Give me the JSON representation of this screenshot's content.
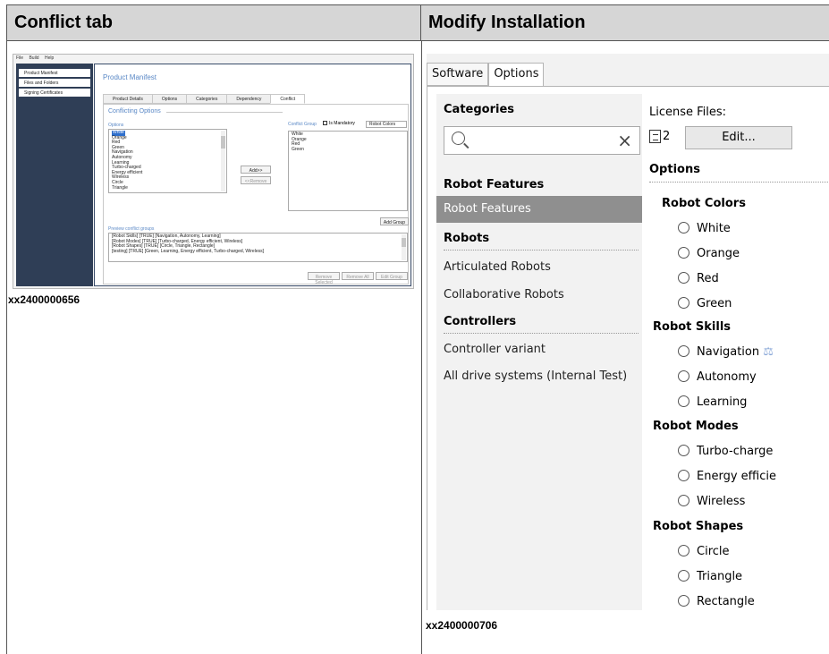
{
  "headers": {
    "left": "Conflict tab",
    "right": "Modify Installation"
  },
  "captions": {
    "left": "xx2400000656",
    "right": "xx2400000706"
  },
  "shot1": {
    "menu": [
      "File",
      "Build",
      "Help"
    ],
    "sidebar": [
      "Product Manifest",
      "Files and Folders",
      "Signing Certificates"
    ],
    "page_title": "Product Manifest",
    "tabs": [
      "Product Details",
      "Options",
      "Categories",
      "Dependency",
      "Conflict"
    ],
    "active_tab": "Conflict",
    "section_title": "Conflicting Options",
    "options_label": "Options",
    "options": [
      "White",
      "Orange",
      "Red",
      "Green",
      "Navigation",
      "Autonomy",
      "Learning",
      "Turbo-charged",
      "Energy efficient",
      "Wireless",
      "Circle",
      "Triangle"
    ],
    "add_button": "Add>>",
    "remove_button": "<<Remove",
    "conflict_group_label": "Conflict Group",
    "is_mandatory_label": "Is Mandatory",
    "is_mandatory_checked": true,
    "group_name": "Robot Colors",
    "group_items": [
      "White",
      "Orange",
      "Red",
      "Green"
    ],
    "add_group_button": "Add Group",
    "preview_label": "Preview conflict groups",
    "preview_lines": [
      "[Robot Skills] [TRUE] [Navigation, Autonomy, Learning]",
      "[Robot Modes] [TRUE] [Turbo-charged, Energy efficient, Wireless]",
      "[Robot Shapes] [TRUE] [Circle, Triangle, Rectangle]",
      "[testing] [TRUE] [Green, Learning, Energy efficient, Turbo-charged, Wireless]"
    ],
    "remove_selected_button": "Remove Selected",
    "remove_all_button": "Remove All",
    "edit_group_button": "Edit Group"
  },
  "shot2": {
    "tabs": [
      "Software",
      "Options"
    ],
    "active_tab": "Options",
    "categories_title": "Categories",
    "search": {
      "value": ""
    },
    "groups": [
      {
        "name": "Robot Features",
        "items": [
          "Robot Features"
        ]
      },
      {
        "name": "Robots",
        "items": [
          "Articulated Robots",
          "Collaborative Robots"
        ]
      },
      {
        "name": "Controllers",
        "items": [
          "Controller variant",
          "All drive systems (Internal Test)"
        ]
      }
    ],
    "selected_item": "Robot Features",
    "license_label": "License Files:",
    "license_count": "2",
    "edit_button": "Edit...",
    "options_title": "Options",
    "option_groups": [
      {
        "name": "Robot Colors",
        "options": [
          "White",
          "Orange",
          "Red",
          "Green"
        ]
      },
      {
        "name": "Robot Skills",
        "options": [
          "Navigation",
          "Autonomy",
          "Learning"
        ]
      },
      {
        "name": "Robot Modes",
        "options": [
          "Turbo-charge",
          "Energy efficie",
          "Wireless"
        ]
      },
      {
        "name": "Robot Shapes",
        "options": [
          "Circle",
          "Triangle",
          "Rectangle"
        ]
      }
    ]
  }
}
